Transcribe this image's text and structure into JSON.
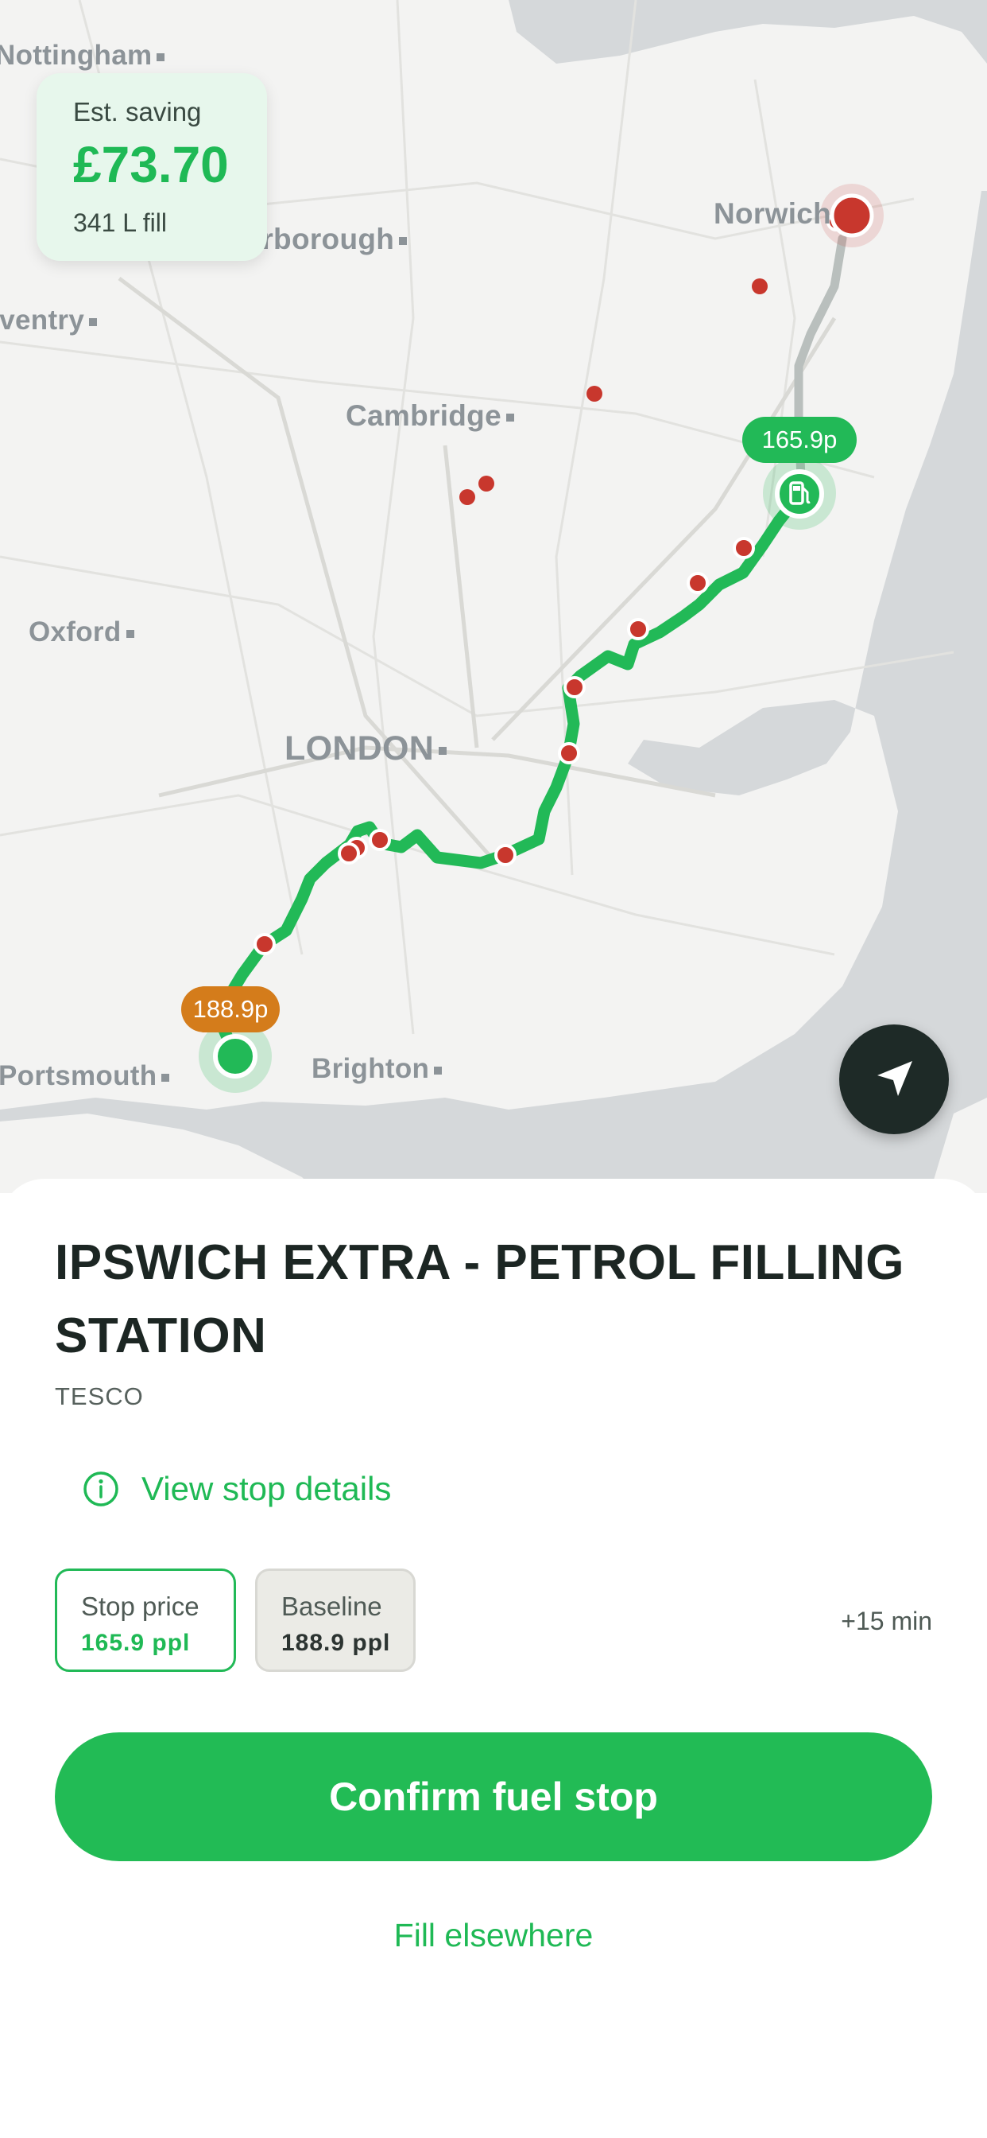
{
  "map": {
    "cities": {
      "nottingham": "Nottingham",
      "peterborough": "Peterborough",
      "coventry": "Coventry",
      "cambridge": "Cambridge",
      "norwich": "Norwich",
      "oxford": "Oxford",
      "london": "LONDON",
      "portsmouth": "Portsmouth",
      "brighton": "Brighton"
    },
    "stop_price_pill": "165.9p",
    "start_price_pill": "188.9p",
    "colors": {
      "route": "#22b957",
      "stations": "#c8372d",
      "water": "#d5d8da"
    }
  },
  "saving_card": {
    "label": "Est. saving",
    "value": "£73.70",
    "fill": "341 L fill"
  },
  "station": {
    "name": "IPSWICH EXTRA - PETROL FILLING STATION",
    "brand": "TESCO"
  },
  "details_link": "View stop details",
  "chips": {
    "stop_label": "Stop price",
    "stop_value": "165.9 ppl",
    "baseline_label": "Baseline",
    "baseline_value": "188.9 ppl"
  },
  "detour": "+15 min",
  "confirm_label": "Confirm fuel stop",
  "fill_elsewhere": "Fill elsewhere",
  "icons": {
    "locate": "navigation-arrow-icon",
    "info": "info-circle-icon",
    "pump": "fuel-pump-icon"
  }
}
